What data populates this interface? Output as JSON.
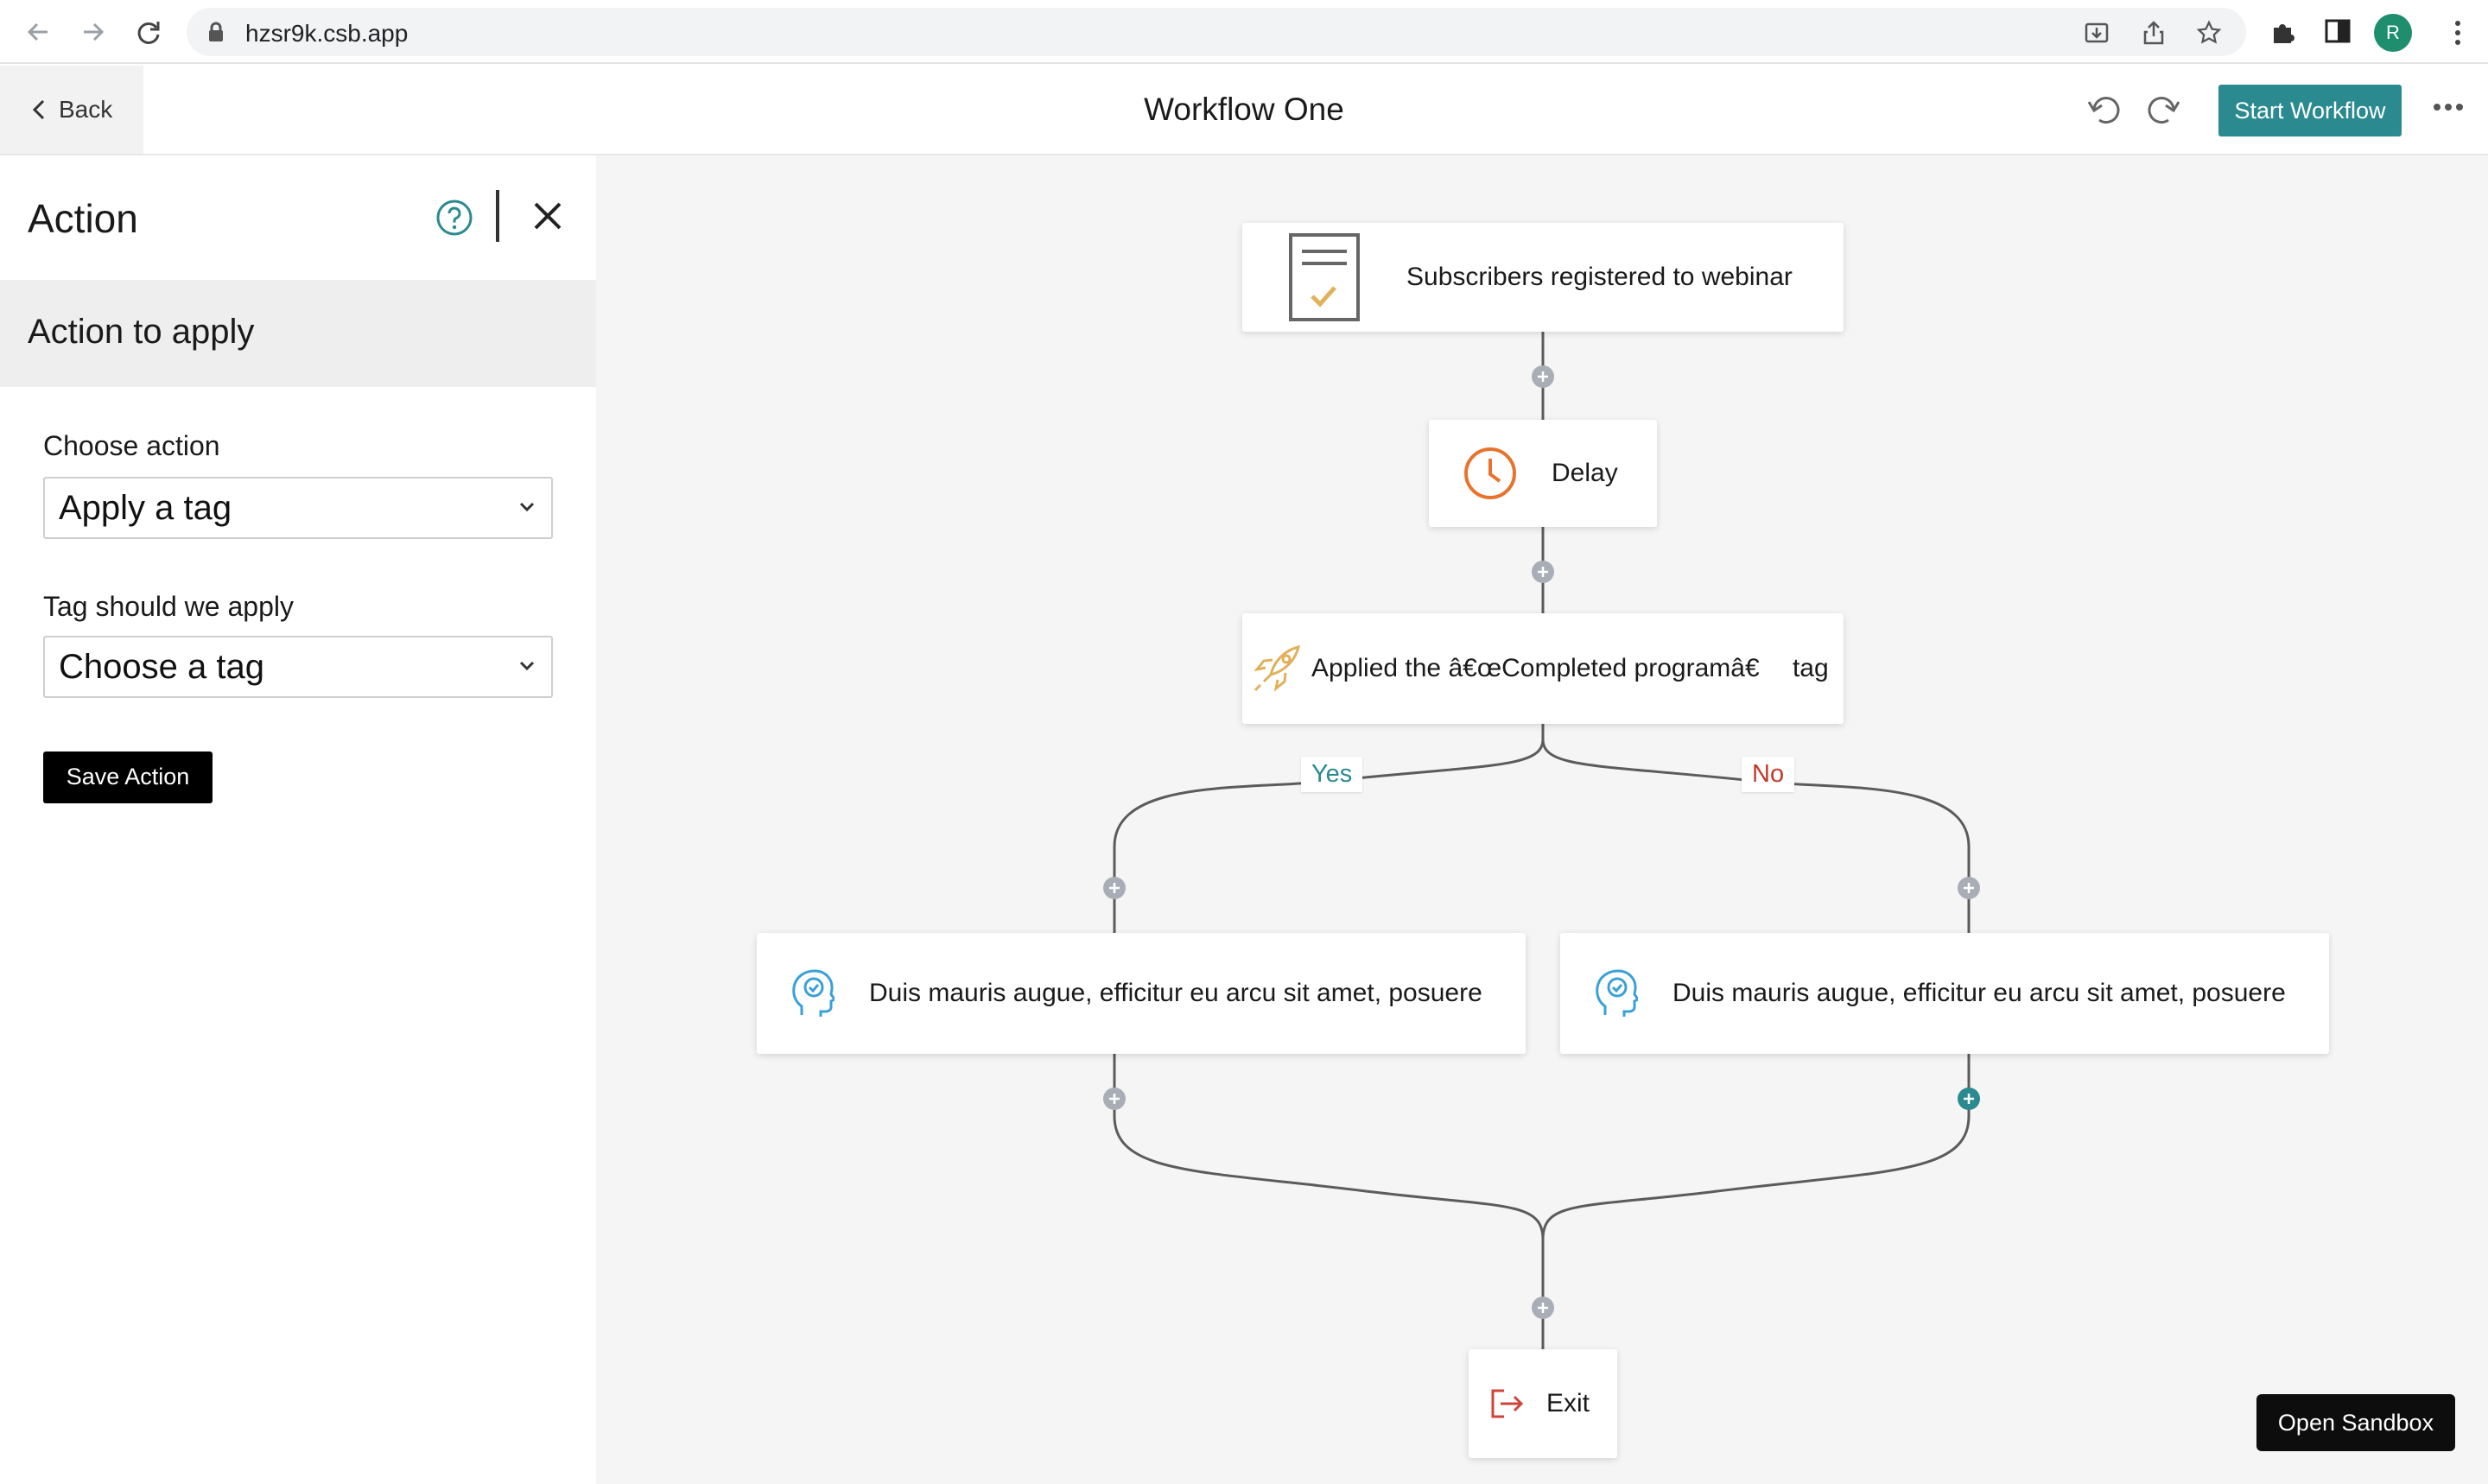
{
  "browser": {
    "url": "hzsr9k.csb.app",
    "profile_initial": "R"
  },
  "header": {
    "back_label": "Back",
    "title": "Workflow One",
    "start_label": "Start Workflow"
  },
  "panel": {
    "title": "Action",
    "section_title": "Action to apply",
    "choose_action_label": "Choose action",
    "choose_action_value": "Apply a tag",
    "tag_label": "Tag should we apply",
    "tag_value": "Choose a tag",
    "save_label": "Save Action"
  },
  "flow": {
    "trigger": {
      "label": "Subscribers registered to webinar",
      "icon": "checklist-icon"
    },
    "delay": {
      "label": "Delay",
      "icon": "clock-icon"
    },
    "action": {
      "label": "Applied the â€œCompleted programâ€  tag",
      "icon": "rocket-icon"
    },
    "branch_yes": "Yes",
    "branch_no": "No",
    "left_step": {
      "label": "Duis mauris augue, efficitur eu arcu sit amet, posuere",
      "icon": "head-check-icon"
    },
    "right_step": {
      "label": "Duis mauris augue, efficitur eu arcu sit amet, posuere",
      "icon": "head-check-icon"
    },
    "exit": {
      "label": "Exit",
      "icon": "exit-icon"
    }
  },
  "sandbox_label": "Open Sandbox",
  "colors": {
    "accent": "#2a8a8f",
    "yes": "#2a8a8f",
    "no": "#c0392b",
    "delay_icon": "#e8732c",
    "rocket_icon": "#e0b15a",
    "exit_icon": "#d0433a",
    "head_icon": "#3aa0d8"
  }
}
